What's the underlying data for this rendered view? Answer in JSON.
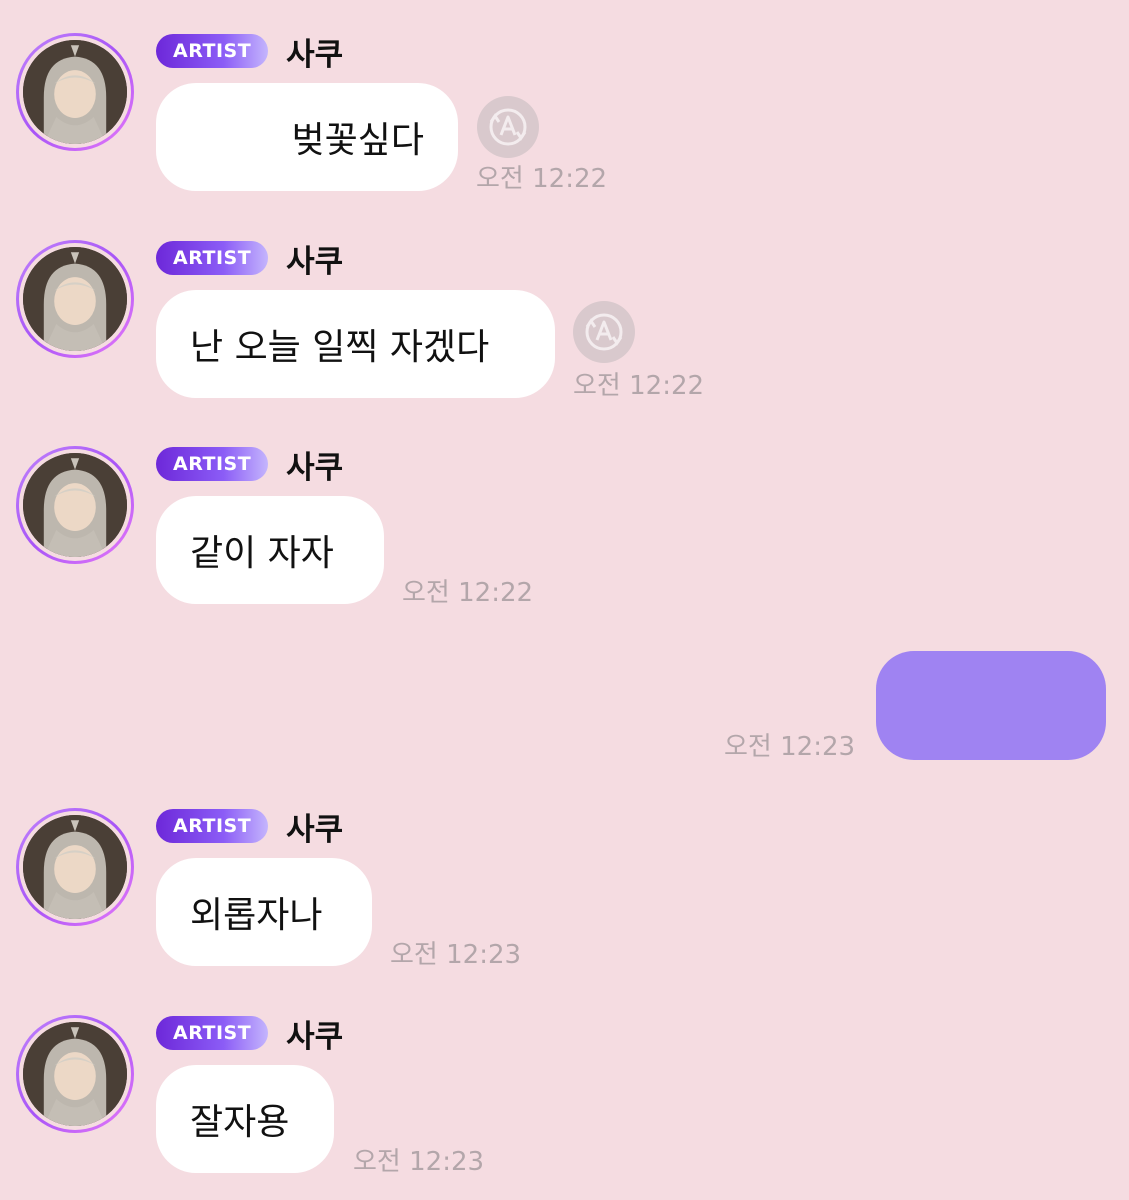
{
  "sender": {
    "badge": "ARTIST",
    "name": "사쿠"
  },
  "messages": [
    {
      "text": "벚꽃싶다",
      "time": "오전 12:22",
      "translate_icon": "translate-a-icon"
    },
    {
      "text": "난 오늘 일찍 자겠다",
      "time": "오전 12:22",
      "translate_icon": "translate-a-icon"
    },
    {
      "text": "같이 자자",
      "time": "오전 12:22"
    },
    {
      "text": "외롭자나",
      "time": "오전 12:23"
    },
    {
      "text": "잘자용",
      "time": "오전 12:23"
    }
  ],
  "my_message": {
    "text": "",
    "time": "오전 12:23",
    "color": "#9f83f2"
  },
  "colors": {
    "background": "#f5dce1",
    "badge_start": "#6d28d9",
    "badge_end": "#c4b5fd"
  }
}
